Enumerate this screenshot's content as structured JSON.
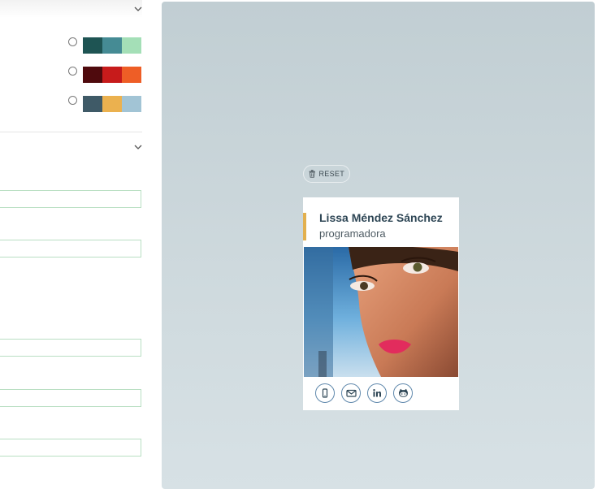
{
  "colors": {
    "field_border": "#b9dfc3",
    "card_accent": "#e2b04f",
    "name_text": "#2f4756",
    "social_ring": "#5f88ac"
  },
  "form": {
    "sections": [
      {
        "name": "color-palettes",
        "collapse_icon": "chevron-down-icon"
      },
      {
        "name": "contact-info",
        "collapse_icon": "chevron-down-icon"
      }
    ],
    "palettes": [
      {
        "id": "palette-1",
        "selected": false,
        "colors": [
          "#1e5453",
          "#458b94",
          "#a4dfb7"
        ]
      },
      {
        "id": "palette-2",
        "selected": false,
        "colors": [
          "#4f0a0d",
          "#c71b1b",
          "#ee5e26"
        ]
      },
      {
        "id": "palette-3",
        "selected": false,
        "colors": [
          "#3f5a67",
          "#ebb14f",
          "#a2c4d5"
        ]
      }
    ],
    "fields": [
      {
        "value": ""
      },
      {
        "value": ""
      },
      {
        "value": ""
      },
      {
        "value": ""
      },
      {
        "value": ""
      }
    ]
  },
  "preview": {
    "reset_label": "RESET",
    "reset_icon": "trash-icon",
    "card": {
      "name": "Lissa Méndez Sánchez",
      "role": "programadora",
      "social": [
        {
          "icon": "mobile-phone-icon"
        },
        {
          "icon": "envelope-icon"
        },
        {
          "icon": "linkedin-icon"
        },
        {
          "icon": "github-icon"
        }
      ]
    }
  }
}
